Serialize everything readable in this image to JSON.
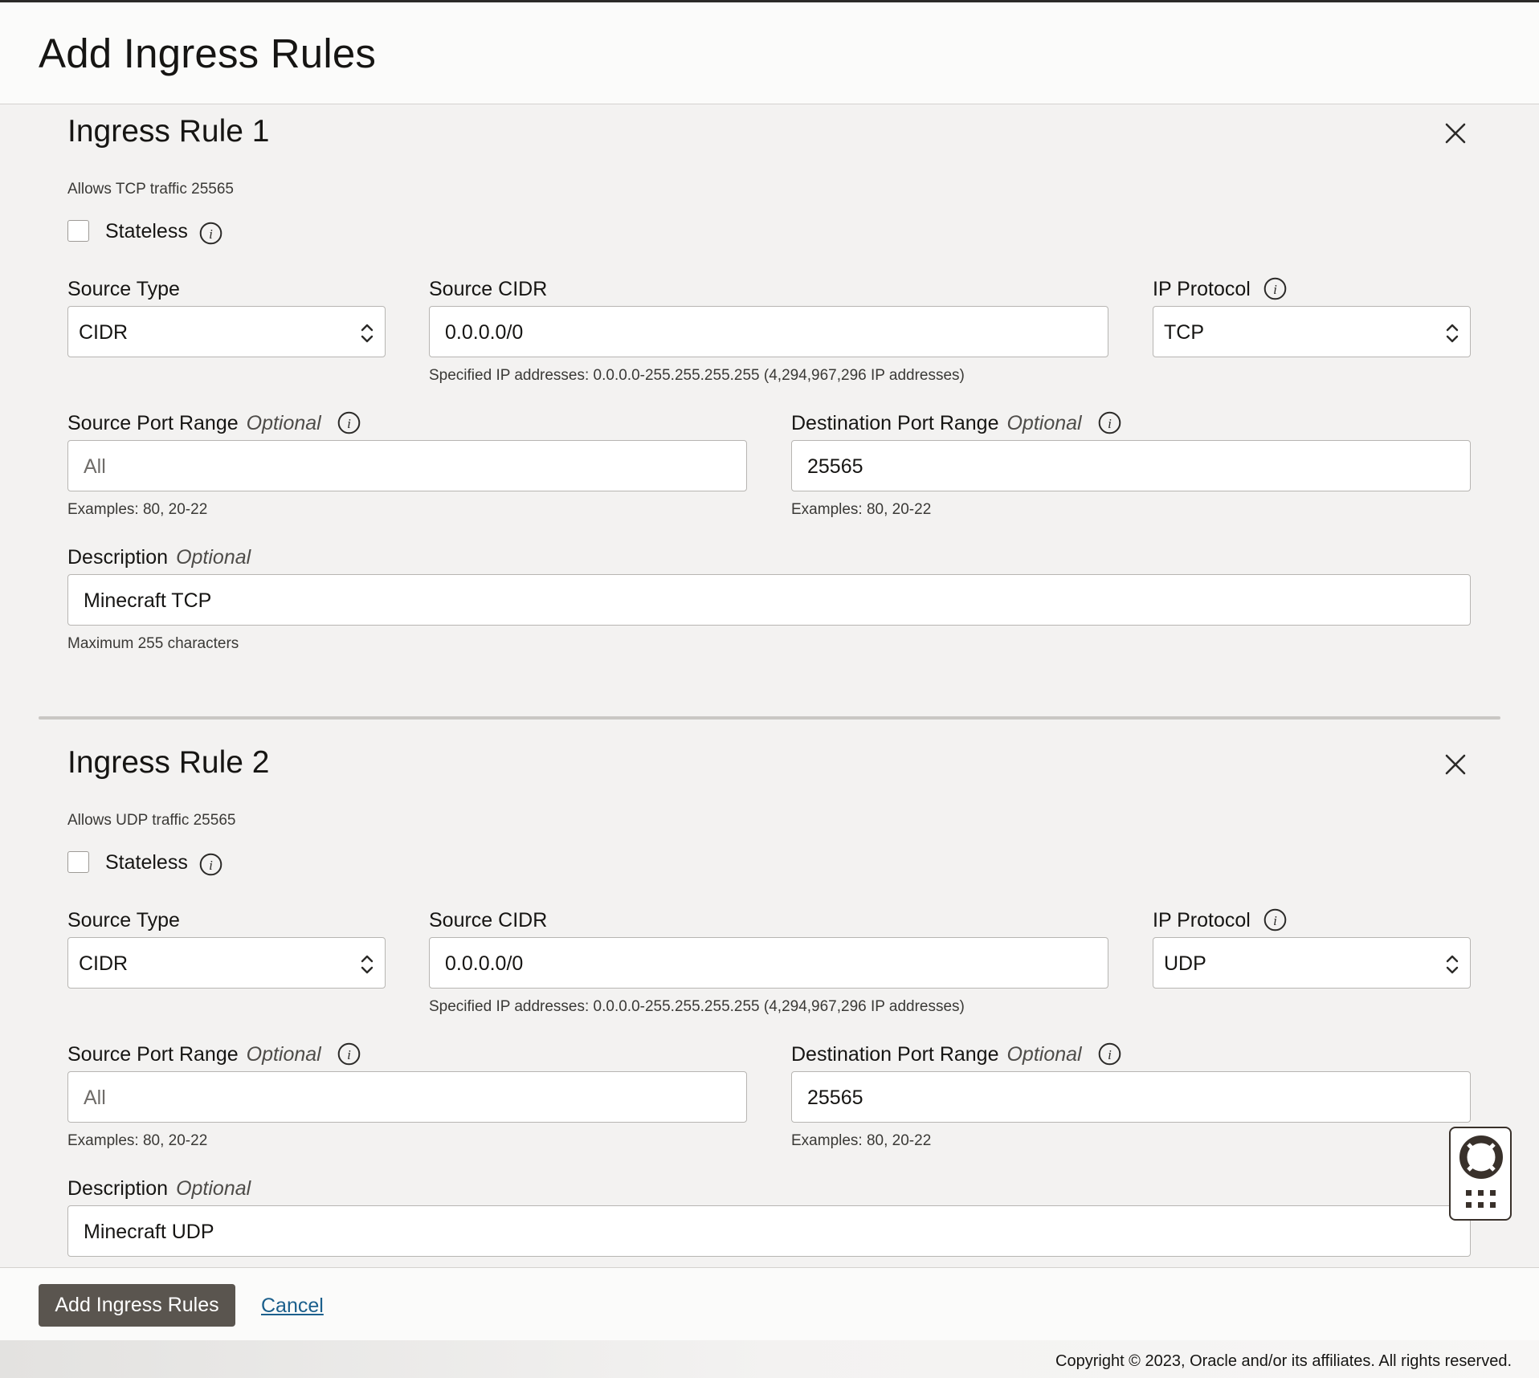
{
  "page": {
    "title": "Add Ingress Rules"
  },
  "rules": [
    {
      "title": "Ingress Rule 1",
      "summary": "Allows TCP traffic 25565",
      "stateless_label": "Stateless",
      "source_type_label": "Source Type",
      "source_type_value": "CIDR",
      "source_cidr_label": "Source CIDR",
      "source_cidr_value": "0.0.0.0/0",
      "source_cidr_help": "Specified IP addresses: 0.0.0.0-255.255.255.255 (4,294,967,296 IP addresses)",
      "ip_protocol_label": "IP Protocol",
      "ip_protocol_value": "TCP",
      "source_port_label": "Source Port Range",
      "source_port_placeholder": "All",
      "source_port_help": "Examples: 80, 20-22",
      "dest_port_label": "Destination Port Range",
      "dest_port_value": "25565",
      "dest_port_help": "Examples: 80, 20-22",
      "description_label": "Description",
      "description_value": "Minecraft TCP",
      "description_help": "Maximum 255 characters",
      "optional_label": "Optional"
    },
    {
      "title": "Ingress Rule 2",
      "summary": "Allows UDP traffic 25565",
      "stateless_label": "Stateless",
      "source_type_label": "Source Type",
      "source_type_value": "CIDR",
      "source_cidr_label": "Source CIDR",
      "source_cidr_value": "0.0.0.0/0",
      "source_cidr_help": "Specified IP addresses: 0.0.0.0-255.255.255.255 (4,294,967,296 IP addresses)",
      "ip_protocol_label": "IP Protocol",
      "ip_protocol_value": "UDP",
      "source_port_label": "Source Port Range",
      "source_port_placeholder": "All",
      "source_port_help": "Examples: 80, 20-22",
      "dest_port_label": "Destination Port Range",
      "dest_port_value": "25565",
      "dest_port_help": "Examples: 80, 20-22",
      "description_label": "Description",
      "description_value": "Minecraft UDP",
      "optional_label": "Optional"
    }
  ],
  "footer": {
    "primary_label": "Add Ingress Rules",
    "cancel_label": "Cancel"
  },
  "copyright": "Copyright © 2023, Oracle and/or its affiliates. All rights reserved.",
  "icons": {
    "close": "close-icon",
    "info": "info-icon",
    "select": "chevron-up-down-icon",
    "help_widget": "lifebuoy-icon",
    "apps": "grid-dots-icon"
  }
}
